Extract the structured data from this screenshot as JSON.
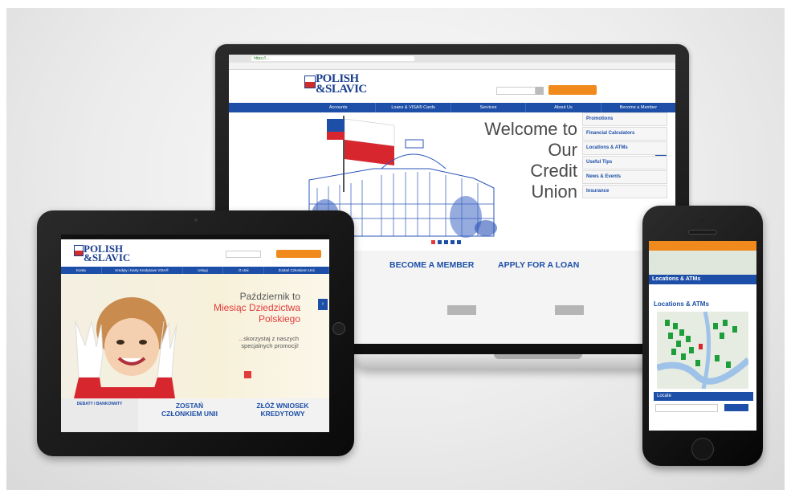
{
  "laptop": {
    "url": "https://...",
    "logo_line1": "POLISH",
    "logo_line2": "&SLAVIC",
    "nav": [
      "Accounts",
      "Loans & VISA® Cards",
      "Services",
      "About Us",
      "Become a Member"
    ],
    "hero_line1": "Welcome to",
    "hero_line2": "Our",
    "hero_line3": "Credit",
    "hero_line4": "Union",
    "side_links": [
      "Promotions",
      "Financial Calculators",
      "Locations & ATMs",
      "Useful Tips",
      "News & Events",
      "Insurance"
    ],
    "promo1": "BECOME A MEMBER",
    "promo2": "APPLY FOR A LOAN"
  },
  "tablet": {
    "logo_line1": "POLISH",
    "logo_line2": "&SLAVIC",
    "nav": [
      "Konta",
      "Kredyty i Karty Kredytowe VISA®",
      "Usługi",
      "O Unii",
      "Zostań Członkiem Unii"
    ],
    "headline1": "Październik to",
    "headline2": "Miesiąc Dziedzictwa",
    "headline3": "Polskiego",
    "sub1": "...skorzystaj z naszych",
    "sub2": "specjalnych promocji!",
    "box1": "DEBATY I BANKOWATY",
    "box2_line1": "ZOSTAŃ",
    "box2_line2": "CZŁONKIEM UNII",
    "box3_line1": "ZŁÓŻ WNIOSEK",
    "box3_line2": "KREDYTOWY"
  },
  "phone": {
    "band": "Locations & ATMs",
    "title": "Locations & ATMs",
    "locate": "Locate"
  }
}
